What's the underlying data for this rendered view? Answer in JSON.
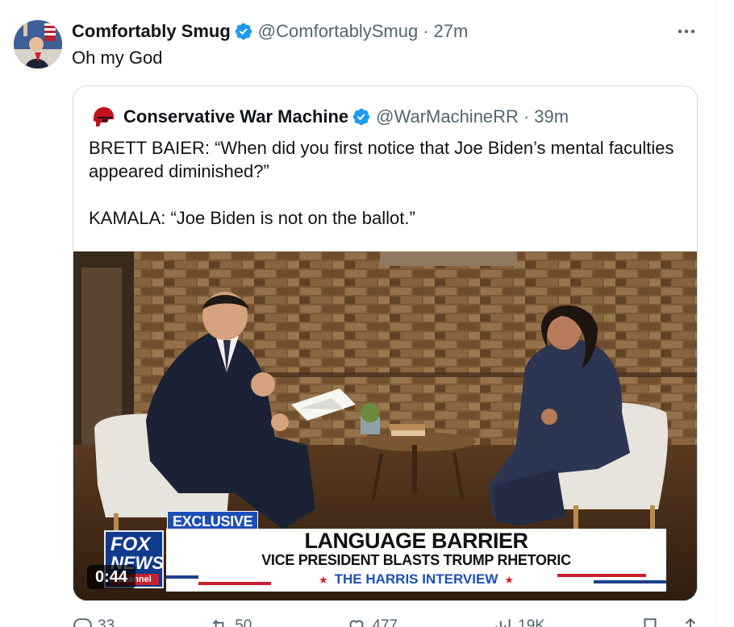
{
  "tweet": {
    "author_name": "Comfortably Smug",
    "handle": "@ComfortablySmug",
    "separator": "·",
    "time": "27m",
    "text": "Oh my God"
  },
  "quote": {
    "author_name": "Conservative War Machine",
    "handle": "@WarMachineRR",
    "separator": "·",
    "time": "39m",
    "text_line1": "BRETT BAIER: “When did you first notice that Joe Biden’s mental faculties appeared diminished?”",
    "text_line2": "KAMALA: “Joe Biden is not on the ballot.”",
    "media": {
      "duration": "0:44",
      "exclusive_tag": "EXCLUSIVE",
      "headline": "LANGUAGE BARRIER",
      "subheadline": "VICE PRESIDENT BLASTS TRUMP RHETORIC",
      "strip": "THE HARRIS INTERVIEW",
      "logo_fox": "FOX",
      "logo_news": "NEWS",
      "logo_channel": "channel"
    }
  },
  "actions": {
    "reply": "33",
    "repost": "50",
    "like": "477",
    "views": "19K"
  },
  "icons": {
    "verified": "verified-badge-icon",
    "more": "more-icon",
    "reply": "reply-icon",
    "repost": "repost-icon",
    "like": "like-icon",
    "views": "views-icon",
    "bookmark": "bookmark-icon",
    "share": "share-icon"
  },
  "colors": {
    "verified": "#1d9bf0",
    "text": "#0f1419",
    "secondary": "#536471",
    "border": "#cfd9de",
    "fox_blue": "#123a8c",
    "fox_red": "#c8202c"
  }
}
